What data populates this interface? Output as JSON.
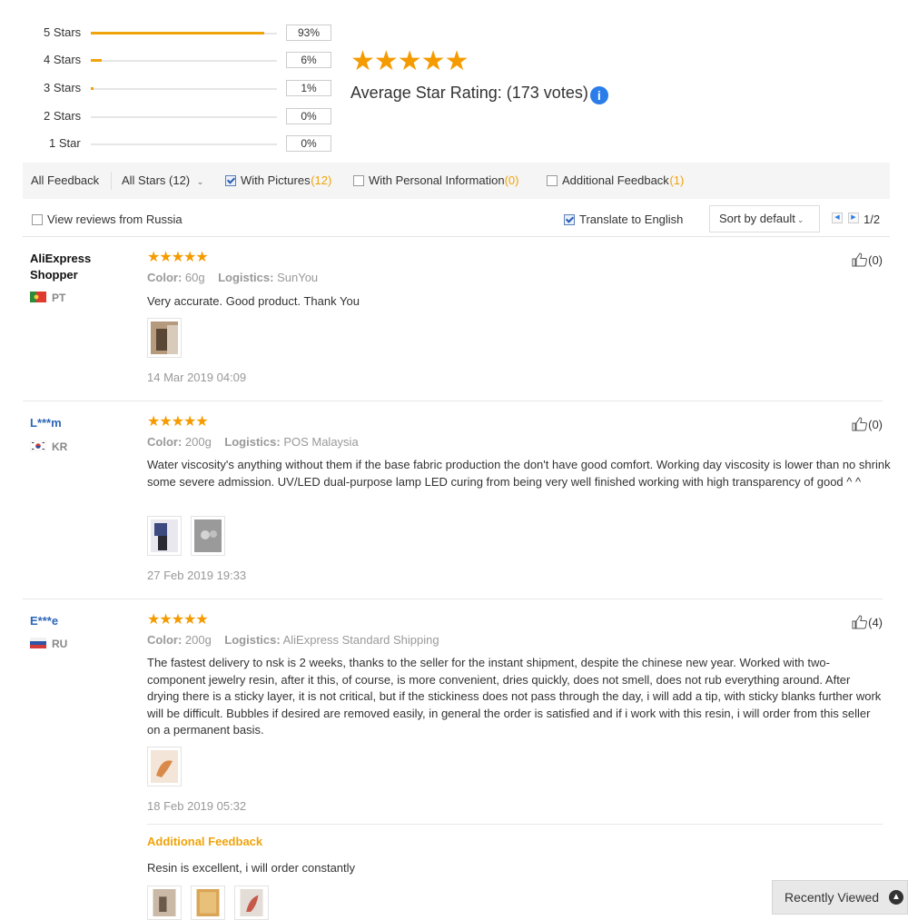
{
  "rating_summary": {
    "rows": [
      {
        "label": "5 Stars",
        "percent_text": "93%",
        "percent": 93
      },
      {
        "label": "4 Stars",
        "percent_text": "6%",
        "percent": 6
      },
      {
        "label": "3 Stars",
        "percent_text": "1%",
        "percent": 1
      },
      {
        "label": "2 Stars",
        "percent_text": "0%",
        "percent": 0
      },
      {
        "label": "1 Star",
        "percent_text": "0%",
        "percent": 0
      }
    ],
    "stars": "★★★★★",
    "average_label": "Average Star Rating:",
    "votes": "(173 votes)",
    "info_glyph": "i"
  },
  "filters": {
    "all_feedback": "All Feedback",
    "all_stars": "All Stars (12)",
    "with_pictures": "With Pictures",
    "with_pictures_count": "(12)",
    "with_personal": "With Personal Information",
    "with_personal_count": "(0)",
    "additional": "Additional Feedback",
    "additional_count": "(1)"
  },
  "toolbar": {
    "view_russia": "View reviews from Russia",
    "translate": "Translate to English",
    "sort": "Sort by default",
    "page": "1/2"
  },
  "reviews": [
    {
      "name": "AliExpress Shopper",
      "country": "PT",
      "stars": "★★★★★",
      "color_label": "Color:",
      "color": "60g",
      "logistics_label": "Logistics:",
      "logistics": "SunYou",
      "text": "Very accurate. Good product. Thank You",
      "date": "14 Mar 2019 04:09",
      "likes": "(0)"
    },
    {
      "name": "L***m",
      "country": "KR",
      "stars": "★★★★★",
      "color_label": "Color:",
      "color": "200g",
      "logistics_label": "Logistics:",
      "logistics": "POS Malaysia",
      "text": "Water viscosity's anything without them if the base fabric production the don't have good comfort. Working day viscosity is lower than no shrink some severe admission. UV/LED dual-purpose lamp LED curing from being very well finished working with high transparency of good ^ ^",
      "date": "27 Feb 2019 19:33",
      "likes": "(0)"
    },
    {
      "name": "E***e",
      "country": "RU",
      "stars": "★★★★★",
      "color_label": "Color:",
      "color": "200g",
      "logistics_label": "Logistics:",
      "logistics": "AliExpress Standard Shipping",
      "text": "The fastest delivery to nsk is 2 weeks, thanks to the seller for the instant shipment, despite the chinese new year. Worked with two-component jewelry resin, after it this, of course, is more convenient, dries quickly, does not smell, does not rub everything around. After drying there is a sticky layer, it is not critical, but if the stickiness does not pass through the day, i will add a tip, with sticky blanks further work will be difficult. Bubbles if desired are removed easily, in general the order is satisfied and if i work with this resin, i will order from this seller on a permanent basis.",
      "date": "18 Feb 2019 05:32",
      "likes": "(4)",
      "additional_title": "Additional Feedback",
      "additional_text": "Resin is excellent, i will order constantly"
    }
  ],
  "recently_viewed": "Recently Viewed",
  "colors": {
    "star": "#f59b00",
    "accent": "#f0a30a",
    "link_blue": "#2e66b8"
  }
}
